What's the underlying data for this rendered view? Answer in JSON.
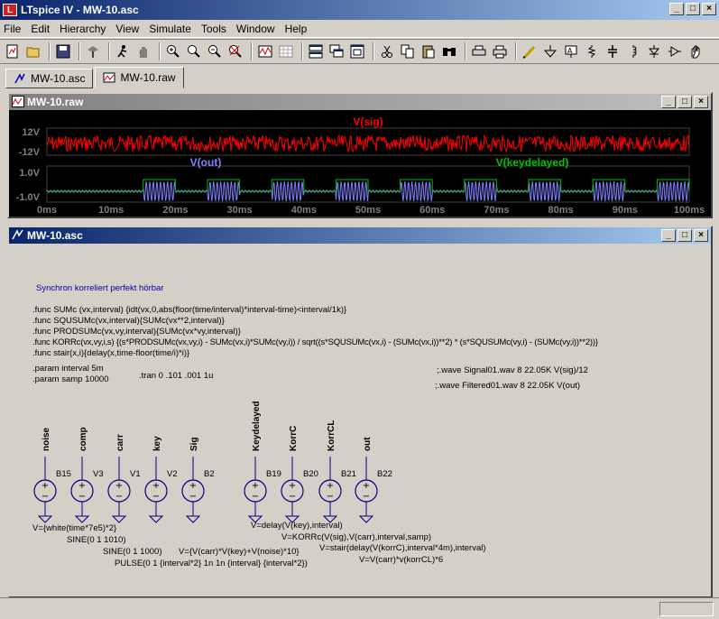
{
  "window": {
    "title": "LTspice IV - MW-10.asc"
  },
  "menu": [
    "File",
    "Edit",
    "Hierarchy",
    "View",
    "Simulate",
    "Tools",
    "Window",
    "Help"
  ],
  "toolbar_icons": [
    "new-schematic-icon",
    "open-icon",
    "save-icon",
    "control-panel-icon",
    "run-icon",
    "halt-icon",
    "zoom-in-icon",
    "zoom-pan-icon",
    "zoom-out-icon",
    "zoom-cancel-icon",
    "autorange-icon",
    "grid-icon",
    "tile-horizontal-icon",
    "cascade-icon",
    "tile-vertical-icon",
    "cut-icon",
    "copy-icon",
    "paste-icon",
    "find-icon",
    "print-setup-icon",
    "print-icon",
    "draw-wire-icon",
    "ground-icon",
    "label-net-icon",
    "resistor-icon",
    "capacitor-icon",
    "inductor-icon",
    "diode-icon",
    "component-icon",
    "move-icon"
  ],
  "tabs": [
    {
      "label": "MW-10.asc"
    },
    {
      "label": "MW-10.raw"
    }
  ],
  "waveform_window": {
    "title": "MW-10.raw",
    "traces": [
      {
        "label": "V(sig)",
        "color": "#ff0000"
      },
      {
        "label": "V(out)",
        "color": "#8080ff"
      },
      {
        "label": "V(keydelayed)",
        "color": "#00c000"
      }
    ],
    "y_ticks_top": [
      "12V",
      "-12V"
    ],
    "y_ticks_bottom": [
      "1.0V",
      "-1.0V"
    ],
    "x_ticks": [
      "0ms",
      "10ms",
      "20ms",
      "30ms",
      "40ms",
      "50ms",
      "60ms",
      "70ms",
      "80ms",
      "90ms",
      "100ms"
    ]
  },
  "schematic_window": {
    "title": "MW-10.asc",
    "comment": "Synchron korreliert perfekt hörbar",
    "directives": [
      ".func SUMc (vx,interval) {idt(vx,0,abs(floor(time/interval)*interval-time)<interval/1k)}",
      ".func SQUSUMc(vx,interval){SUMc(vx**2,interval)}",
      ".func PRODSUMc(vx,vy,interval){SUMc(vx*vy,interval)}",
      ".func KORRc(vx,vy,i,s) {(s*PRODSUMc(vx,vy,i) - SUMc(vx,i)*SUMc(vy,i)) / sqrt((s*SQUSUMc(vx,i) - (SUMc(vx,i))**2) * (s*SQUSUMc(vy,i) - (SUMc(vy,i))**2))}",
      ".func stair(x,i){delay(x,time-floor(time/i)*i)}",
      ".param interval 5m",
      ".param samp 10000"
    ],
    "tran": ".tran 0 .101 .001 1u",
    "wave1": ";.wave Signal01.wav 8 22.05K V(sig)/12",
    "wave2": ";.wave Filtered01.wav 8 22.05K V(out)",
    "sources": [
      {
        "net": "noise",
        "name": "B15"
      },
      {
        "net": "comp",
        "name": "V3"
      },
      {
        "net": "carr",
        "name": "V1"
      },
      {
        "net": "key",
        "name": "V2"
      },
      {
        "net": "Sig",
        "name": "B2"
      },
      {
        "net": "Keydelayed",
        "name": "B19"
      },
      {
        "net": "KorrC",
        "name": "B20"
      },
      {
        "net": "KorrCL",
        "name": "B21"
      },
      {
        "net": "out",
        "name": "B22"
      }
    ],
    "values": [
      "V={white(time*7e5)*2}",
      "SINE(0 1 1010)",
      "SINE(0 1 1000)",
      "V={V(carr)*V(key)+V(noise)*10}",
      "PULSE(0 1 {interval*2} 1n 1n {interval} {interval*2})",
      "V=delay(V(key),interval)",
      "V=KORRc(V(sig),V(carr),interval,samp)",
      "V=stair(delay(V(korrC),interval*4m),interval)",
      "V=V(carr)*v(korrCL)*6"
    ]
  }
}
